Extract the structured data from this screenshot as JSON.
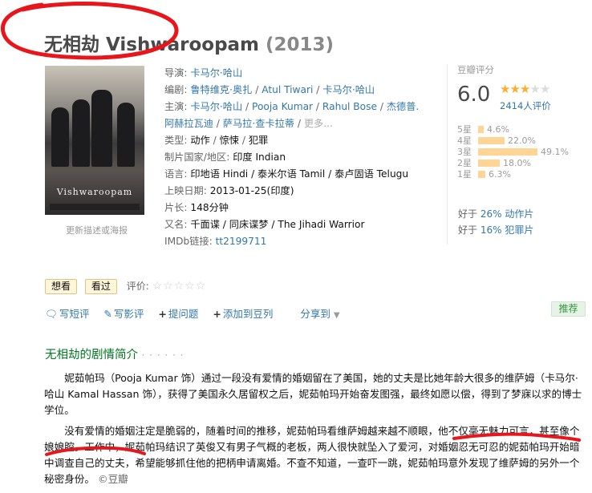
{
  "movie": {
    "title": "无相劫 Vishwaroopam",
    "year": "(2013)"
  },
  "poster": {
    "title_text": "Vishwaroopam",
    "update_link": "更新描述或海报"
  },
  "info": {
    "director": {
      "label": "导演",
      "value": "卡马尔·哈山"
    },
    "writers": {
      "label": "编剧",
      "items": [
        "鲁特维克·奥扎",
        "Atul Tiwari",
        "卡马尔·哈山"
      ]
    },
    "cast": {
      "label": "主演",
      "line1": [
        "卡马尔·哈山",
        "Pooja Kumar",
        "Rahul Bose",
        "杰德普."
      ],
      "line2": [
        "阿赫拉瓦迪",
        "萨马拉·查卡拉蒂"
      ],
      "more": "更多..."
    },
    "genre": {
      "label": "类型",
      "items": [
        "动作",
        "惊悚",
        "犯罪"
      ]
    },
    "country": {
      "label": "制片国家/地区",
      "value": "印度 Indian"
    },
    "language": {
      "label": "语言",
      "value": "印地语 Hindi / 泰米尔语 Tamil / 泰卢固语 Telugu"
    },
    "release": {
      "label": "上映日期",
      "value": "2013-01-25(印度)"
    },
    "runtime": {
      "label": "片长",
      "value": "148分钟"
    },
    "aka": {
      "label": "又名",
      "value": "千面谍 / 同床谍梦 / The Jihadi Warrior"
    },
    "imdb": {
      "label": "IMDb链接",
      "value": "tt2199711"
    }
  },
  "rating": {
    "label": "豆瓣评分",
    "score": "6.0",
    "stars_filled": 3,
    "stars_total": 5,
    "count_text": "2414人评价",
    "breakdown": [
      {
        "star": "5星",
        "percent": 4.6,
        "text": "4.6%"
      },
      {
        "star": "4星",
        "percent": 22.0,
        "text": "22.0%"
      },
      {
        "star": "3星",
        "percent": 49.1,
        "text": "49.1%"
      },
      {
        "star": "2星",
        "percent": 18.0,
        "text": "18.0%"
      },
      {
        "star": "1星",
        "percent": 6.3,
        "text": "6.3%"
      }
    ],
    "better_than": [
      {
        "prefix": "好于",
        "pct": "26%",
        "genre": "动作片"
      },
      {
        "prefix": "好于",
        "pct": "16%",
        "genre": "犯罪片"
      }
    ]
  },
  "actions": {
    "want": "想看",
    "seen": "看过",
    "rate_label": "评价:",
    "rate_stars": "☆☆☆☆☆"
  },
  "links": {
    "short_review": "写短评",
    "review": "写影评",
    "ask": "提问题",
    "add_list": "添加到豆列",
    "share": "分享到",
    "recommend": "推荐"
  },
  "summary": {
    "heading": "无相劫的剧情简介",
    "dots": "· · · · · ·",
    "p1": "妮茹帕玛（Pooja Kumar 饰）通过一段没有爱情的婚姻留在了美国，她的丈夫是比她年龄大很多的维萨姆（卡马尔·哈山 Kamal Hassan 饰），获得了美国永久居留权之后，妮茹帕玛开始奋发图强，最终如愿以偿，得到了梦寐以求的博士学位。",
    "p2": "没有爱情的婚姻注定是脆弱的，随着时间的推移，妮茹帕玛看维萨姆越来越不顺眼，他不仅毫无魅力可言，甚至像个娘娘腔。工作中，妮茹帕玛结识了英俊又有男子气概的老板，两人很快就坠入了爱河，对婚姻忍无可忍的妮茹帕玛开始暗中调查自己的丈夫，希望能够抓住他的把柄申请离婚。不查不知道，一查吓一跳，妮茹帕玛意外发现了维萨姆的另外一个秘密身份。",
    "source": "©豆瓣"
  },
  "annotation_color": "#e8151b"
}
